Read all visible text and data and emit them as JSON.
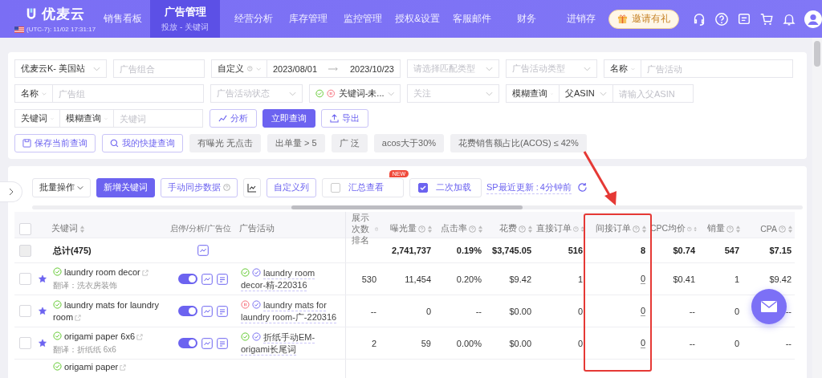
{
  "header": {
    "logo": "优麦云",
    "timezone": "(UTC-7): 11/02 17:31:17",
    "invite": "邀请有礼",
    "nav": [
      {
        "label": "销售看板",
        "selected": false
      },
      {
        "label": "广告管理",
        "selected": true,
        "subtitle": "投放 - 关键词"
      },
      {
        "label": "经营分析",
        "selected": false
      },
      {
        "label": "库存管理",
        "selected": false
      },
      {
        "label": "监控管理",
        "selected": false
      },
      {
        "label": "授权&设置",
        "selected": false
      },
      {
        "label": "客服邮件",
        "selected": false
      },
      {
        "label": "财务",
        "selected": false
      },
      {
        "label": "进销存",
        "selected": false
      }
    ]
  },
  "filters": {
    "row_1": [
      {
        "parts": [
          {
            "kind": "select",
            "value": "优麦云K- 美国站"
          }
        ]
      },
      {
        "parts": [
          {
            "kind": "input",
            "placeholder": "广告组合"
          }
        ]
      },
      {
        "parts": [
          {
            "kind": "select",
            "value": "自定义",
            "help": true
          },
          {
            "kind": "date-range",
            "start": "2023/08/01",
            "end": "2023/10/23"
          }
        ]
      },
      {
        "parts": [
          {
            "kind": "select",
            "placeholder": "请选择匹配类型"
          }
        ]
      },
      {
        "parts": [
          {
            "kind": "select",
            "placeholder": "广告活动类型"
          }
        ]
      },
      {
        "parts": [
          {
            "kind": "select",
            "value": "名称"
          },
          {
            "kind": "input",
            "placeholder": "广告活动"
          }
        ]
      }
    ],
    "row_2": [
      {
        "parts": [
          {
            "kind": "select",
            "value": "名称"
          },
          {
            "kind": "input",
            "placeholder": "广告组"
          }
        ]
      },
      {
        "parts": [
          {
            "kind": "select",
            "placeholder": "广告活动状态"
          }
        ]
      },
      {
        "parts": [
          {
            "kind": "status-select",
            "value": "关键词-未..."
          }
        ]
      },
      {
        "parts": [
          {
            "kind": "select",
            "placeholder": "关注"
          }
        ]
      },
      {
        "parts": [
          {
            "kind": "select",
            "value": "模糊查询"
          },
          {
            "kind": "select",
            "value": "父ASIN"
          },
          {
            "kind": "input",
            "placeholder": "请输入父ASIN"
          }
        ]
      }
    ],
    "row_3": [
      {
        "parts": [
          {
            "kind": "select",
            "value": "关键词"
          },
          {
            "kind": "select",
            "value": "模糊查询"
          },
          {
            "kind": "input",
            "placeholder": "关键词"
          }
        ]
      }
    ],
    "actions": [
      {
        "kind": "analyze-button",
        "label": "分析"
      },
      {
        "kind": "query-button",
        "label": "立即查询"
      },
      {
        "kind": "export-button",
        "label": "导出"
      }
    ],
    "quick": [
      {
        "kind": "save-button",
        "label": "保存当前查询"
      },
      {
        "kind": "shortcut-button",
        "label": "我的快捷查询"
      },
      {
        "kind": "tag",
        "label": "有曝光 无点击"
      },
      {
        "kind": "tag",
        "label": "出单量 > 5"
      },
      {
        "kind": "tag",
        "label": "广 泛"
      },
      {
        "kind": "tag",
        "label": "acos大于30%"
      },
      {
        "kind": "tag",
        "label": "花费销售额占比(ACOS) ≤ 42%"
      }
    ]
  },
  "toolbar": {
    "bulk": "批量操作",
    "add": "新增关键词",
    "sync": "手动同步数据",
    "columns": "自定义列",
    "summary": {
      "label": "汇总查看",
      "checked": false,
      "badge": "NEW"
    },
    "reload": {
      "label": "二次加载",
      "checked": true
    },
    "updated_label": "SP最近更新 :",
    "updated_value": "4分钟前"
  },
  "table": {
    "header_checked": false,
    "columns": [
      {
        "label": "关键词",
        "help": false,
        "sortable": true
      },
      {
        "label": "启停/分析/广告位",
        "help": false,
        "sortable": false
      },
      {
        "label": "广告活动",
        "help": false,
        "sortable": false
      },
      {
        "label": "展示次数排名",
        "help": true,
        "sortable": false
      },
      {
        "label": "曝光量",
        "help": true,
        "sortable": true
      },
      {
        "label": "点击率",
        "help": true,
        "sortable": true
      },
      {
        "label": "花费",
        "help": true,
        "sortable": true
      },
      {
        "label": "直接订单",
        "help": true,
        "sortable": true
      },
      {
        "label": "间接订单",
        "help": true,
        "sortable": true
      },
      {
        "label": "CPC均价",
        "help": true,
        "sortable": true
      },
      {
        "label": "销量",
        "help": true,
        "sortable": true
      },
      {
        "label": "CPA",
        "help": true,
        "sortable": true
      }
    ],
    "total": {
      "disabled": true,
      "label": "总计(475)",
      "values": [
        "2,741,737",
        "0.19%",
        "$3,745.05",
        "516",
        "8",
        "$0.74",
        "547",
        "$7.15"
      ]
    },
    "rows": [
      {
        "selected": false,
        "starred": true,
        "keyword": "laundry room decor",
        "translation": "翻译：洗衣房装饰",
        "enabled": true,
        "campaign_paused": false,
        "campaign": "laundry room decor-精-220316",
        "values": [
          "530",
          "11,454",
          "0.20%",
          "$9.42",
          "1",
          "0",
          "$0.41",
          "1",
          "$9.42"
        ]
      },
      {
        "selected": false,
        "starred": true,
        "keyword": "laundry mats for laundry room",
        "enabled": true,
        "campaign_paused": true,
        "campaign": "laundry mats for laundry room-广-220316",
        "values": [
          "--",
          "0",
          "--",
          "$0.00",
          "0",
          "0",
          "--",
          "0",
          "--"
        ]
      },
      {
        "selected": false,
        "starred": true,
        "keyword": "origami paper 6x6",
        "translation": "翻译：折纸纸 6x6",
        "enabled": true,
        "campaign_paused": false,
        "campaign": "折纸手动EM-origami长尾词",
        "values": [
          "2",
          "59",
          "0.00%",
          "$0.00",
          "0",
          "0",
          "--",
          "0",
          "--"
        ]
      },
      {
        "keyword": "origami paper"
      }
    ]
  }
}
